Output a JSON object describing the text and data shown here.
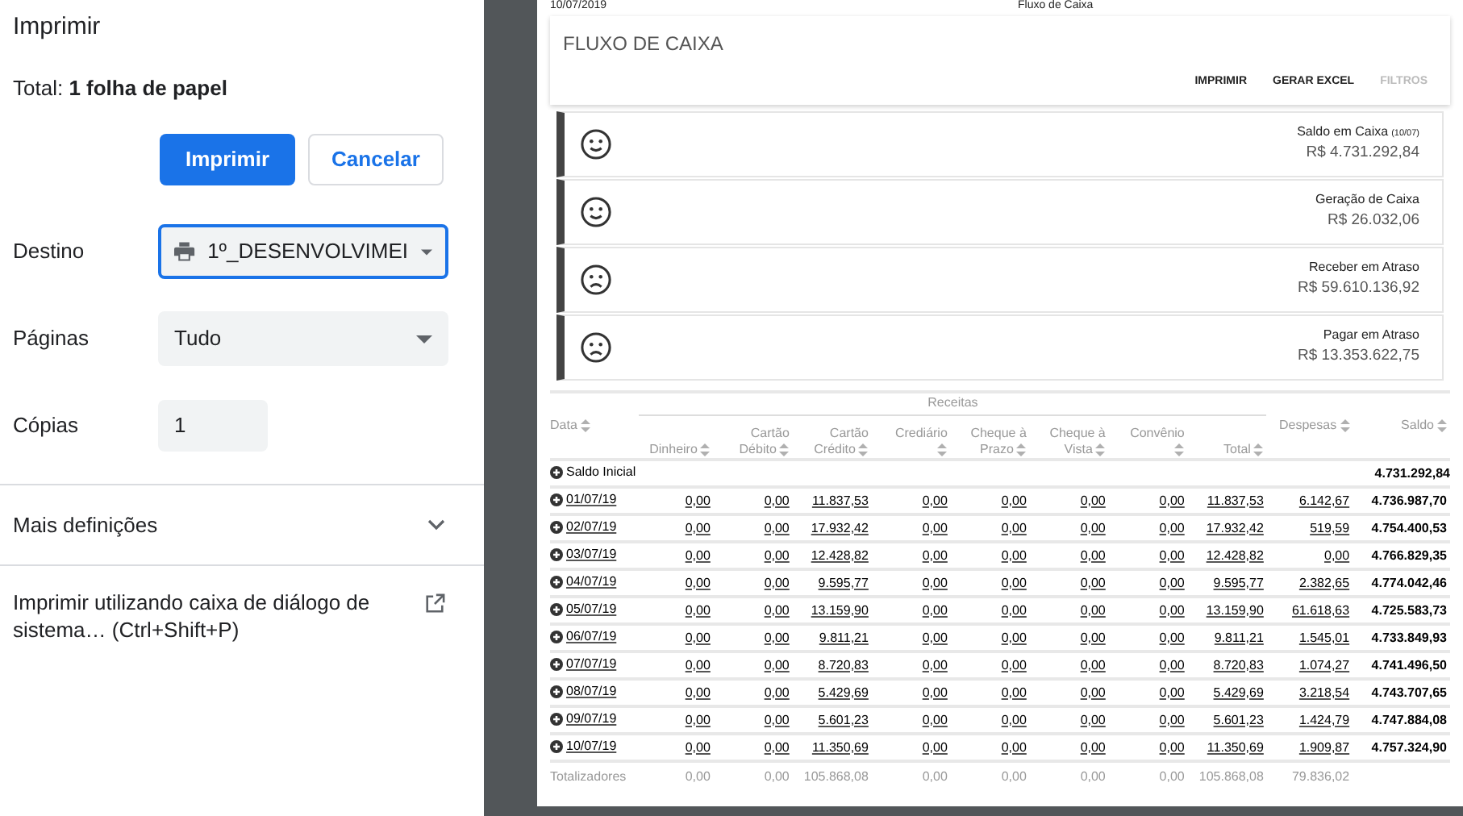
{
  "print_dialog": {
    "title": "Imprimir",
    "summary": "Total: **1 folha de papel**",
    "buttons": [
      {
        "label": "Imprimir",
        "kind": "primary"
      },
      {
        "label": "Cancelar",
        "kind": "secondary"
      }
    ],
    "settings": [
      {
        "label": "Destino",
        "kind": "printer",
        "value": "1º_DESENVOLVIMEI",
        "focused": true
      },
      {
        "label": "Páginas",
        "kind": "select",
        "value": "Tudo",
        "focused": false
      },
      {
        "label": "Cópias",
        "kind": "input",
        "value": "1",
        "focused": false
      }
    ],
    "more_settings": {
      "label": "Mais definições",
      "expanded": false
    },
    "system_dialog": {
      "label": "Imprimir utilizando caixa de diálogo de sistema… (Ctrl+Shift+P)"
    }
  },
  "preview": {
    "page_date": "10/07/2019",
    "page_title": "Fluxo de Caixa",
    "heading": "FLUXO DE CAIXA",
    "actions": [
      {
        "label": "IMPRIMIR",
        "disabled": false
      },
      {
        "label": "GERAR EXCEL",
        "disabled": false
      },
      {
        "label": "FILTROS",
        "disabled": true
      }
    ],
    "cards": [
      {
        "kind": "happy",
        "title": "Saldo em Caixa",
        "note": "(10/07)",
        "value": "R$ 4.731.292,84"
      },
      {
        "kind": "happy",
        "title": "Geração de Caixa",
        "value": "R$ 26.032,06"
      },
      {
        "kind": "sad",
        "title": "Receber em Atraso",
        "value": "R$ 59.610.136,92"
      },
      {
        "kind": "sad",
        "title": "Pagar em Atraso",
        "value": "R$ 13.353.622,75"
      }
    ],
    "table": {
      "column_group": "Receitas",
      "columns": [
        "Data",
        "Dinheiro",
        "Cartão Débito",
        "Cartão Crédito",
        "Crediário",
        "Cheque à Prazo",
        "Cheque à Vista",
        "Convênio",
        "Total",
        "Despesas",
        "Saldo"
      ],
      "opening_row": {
        "label": "Saldo Inicial",
        "saldo": "4.731.292,84"
      },
      "rows": [
        {
          "cells": [
            "01/07/19",
            "0,00",
            "0,00",
            "11.837,53",
            "0,00",
            "0,00",
            "0,00",
            "0,00",
            "11.837,53",
            "6.142,67",
            "4.736.987,70"
          ]
        },
        {
          "cells": [
            "02/07/19",
            "0,00",
            "0,00",
            "17.932,42",
            "0,00",
            "0,00",
            "0,00",
            "0,00",
            "17.932,42",
            "519,59",
            "4.754.400,53"
          ]
        },
        {
          "cells": [
            "03/07/19",
            "0,00",
            "0,00",
            "12.428,82",
            "0,00",
            "0,00",
            "0,00",
            "0,00",
            "12.428,82",
            "0,00",
            "4.766.829,35"
          ]
        },
        {
          "cells": [
            "04/07/19",
            "0,00",
            "0,00",
            "9.595,77",
            "0,00",
            "0,00",
            "0,00",
            "0,00",
            "9.595,77",
            "2.382,65",
            "4.774.042,46"
          ]
        },
        {
          "cells": [
            "05/07/19",
            "0,00",
            "0,00",
            "13.159,90",
            "0,00",
            "0,00",
            "0,00",
            "0,00",
            "13.159,90",
            "61.618,63",
            "4.725.583,73"
          ]
        },
        {
          "cells": [
            "06/07/19",
            "0,00",
            "0,00",
            "9.811,21",
            "0,00",
            "0,00",
            "0,00",
            "0,00",
            "9.811,21",
            "1.545,01",
            "4.733.849,93"
          ]
        },
        {
          "cells": [
            "07/07/19",
            "0,00",
            "0,00",
            "8.720,83",
            "0,00",
            "0,00",
            "0,00",
            "0,00",
            "8.720,83",
            "1.074,27",
            "4.741.496,50"
          ]
        },
        {
          "cells": [
            "08/07/19",
            "0,00",
            "0,00",
            "5.429,69",
            "0,00",
            "0,00",
            "0,00",
            "0,00",
            "5.429,69",
            "3.218,54",
            "4.743.707,65"
          ]
        },
        {
          "cells": [
            "09/07/19",
            "0,00",
            "0,00",
            "5.601,23",
            "0,00",
            "0,00",
            "0,00",
            "0,00",
            "5.601,23",
            "1.424,79",
            "4.747.884,08"
          ]
        },
        {
          "cells": [
            "10/07/19",
            "0,00",
            "0,00",
            "11.350,69",
            "0,00",
            "0,00",
            "0,00",
            "0,00",
            "11.350,69",
            "1.909,87",
            "4.757.324,90"
          ]
        }
      ],
      "totals": [
        "Totalizadores",
        "0,00",
        "0,00",
        "105.868,08",
        "0,00",
        "0,00",
        "0,00",
        "0,00",
        "105.868,08",
        "79.836,02"
      ]
    }
  }
}
